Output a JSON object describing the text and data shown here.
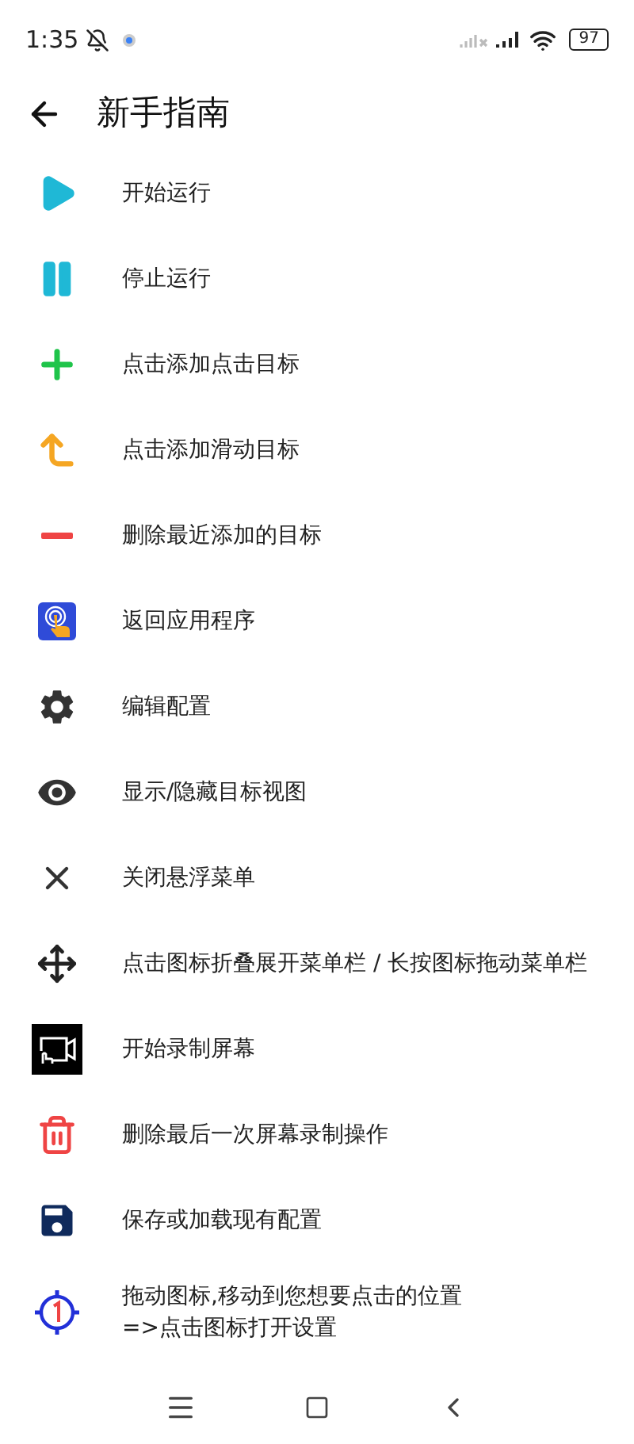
{
  "status_bar": {
    "time": "1:35",
    "battery": "97"
  },
  "header": {
    "title": "新手指南"
  },
  "items": [
    {
      "kind": "play",
      "label": "开始运行"
    },
    {
      "kind": "pause",
      "label": "停止运行"
    },
    {
      "kind": "add",
      "label": "点击添加点击目标"
    },
    {
      "kind": "swipe",
      "label": "点击添加滑动目标"
    },
    {
      "kind": "remove",
      "label": "删除最近添加的目标"
    },
    {
      "kind": "app",
      "label": "返回应用程序"
    },
    {
      "kind": "settings",
      "label": "编辑配置"
    },
    {
      "kind": "eye",
      "label": "显示/隐藏目标视图"
    },
    {
      "kind": "close",
      "label": "关闭悬浮菜单"
    },
    {
      "kind": "move",
      "label": "点击图标折叠展开菜单栏 / 长按图标拖动菜单栏"
    },
    {
      "kind": "record",
      "label": "开始录制屏幕"
    },
    {
      "kind": "trash",
      "label": "删除最后一次屏幕录制操作"
    },
    {
      "kind": "save",
      "label": "保存或加载现有配置"
    },
    {
      "kind": "target",
      "label": "拖动图标,移动到您想要点击的位置\n=>点击图标打开设置"
    }
  ]
}
